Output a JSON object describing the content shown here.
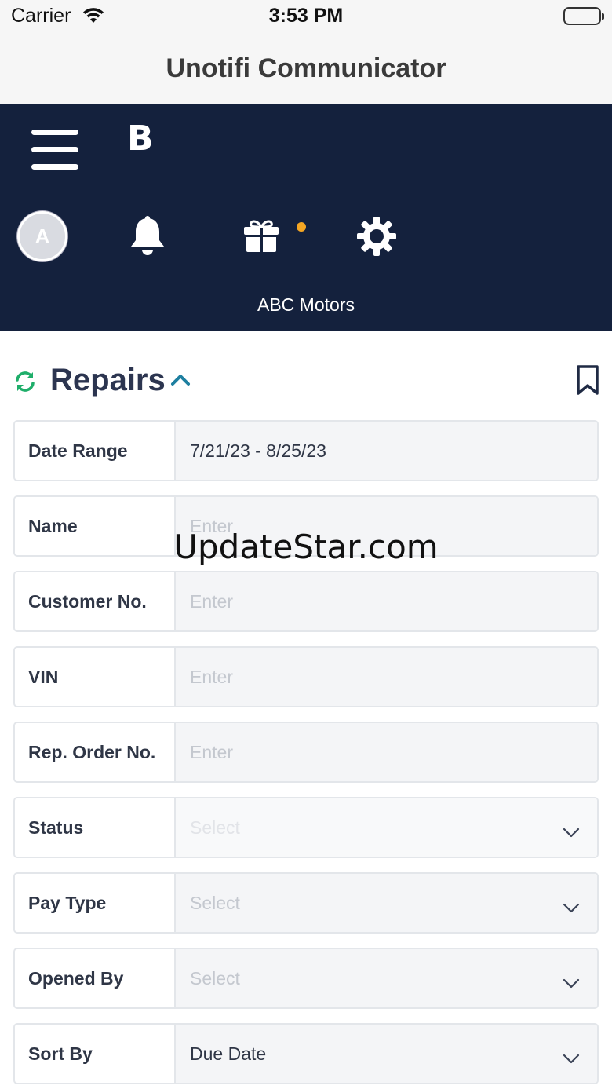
{
  "status_bar": {
    "carrier": "Carrier",
    "time": "3:53 PM"
  },
  "nav_bar": {
    "title": "Unotifi Communicator"
  },
  "header": {
    "brand_letter": "B",
    "avatar_initial": "A",
    "dealer_name": "ABC Motors",
    "notification_dot_color": "#f5a623",
    "background_color": "#14213d"
  },
  "section": {
    "title": "Repairs"
  },
  "form": {
    "rows": [
      {
        "label": "Date Range",
        "value": "7/21/23 - 8/25/23",
        "kind": "input"
      },
      {
        "label": "Name",
        "placeholder": "Enter",
        "kind": "input"
      },
      {
        "label": "Customer No.",
        "placeholder": "Enter",
        "kind": "input"
      },
      {
        "label": "VIN",
        "placeholder": "Enter",
        "kind": "input"
      },
      {
        "label": "Rep. Order No.",
        "placeholder": "Enter",
        "kind": "input"
      },
      {
        "label": "Status",
        "placeholder": "Select",
        "kind": "select"
      },
      {
        "label": "Pay Type",
        "placeholder": "Select",
        "kind": "select"
      },
      {
        "label": "Opened By",
        "placeholder": "Select",
        "kind": "select"
      },
      {
        "label": "Sort By",
        "value": "Due Date",
        "kind": "select"
      }
    ]
  },
  "watermark": "UpdateStar.com"
}
